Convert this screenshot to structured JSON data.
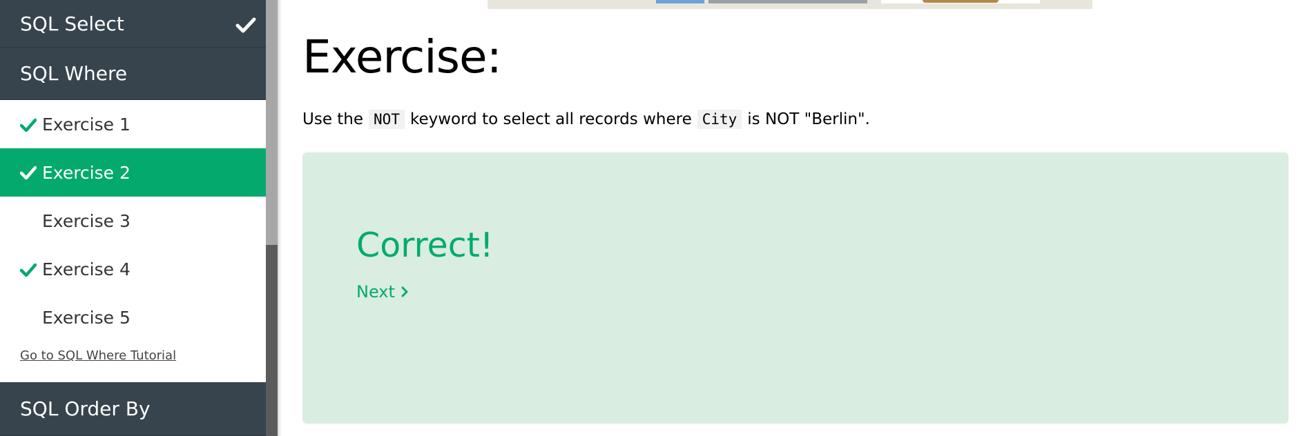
{
  "sidebar": {
    "sections": [
      {
        "label": "SQL Select",
        "completed": true
      },
      {
        "label": "SQL Where",
        "completed": false
      },
      {
        "label": "SQL Order By",
        "completed": false
      }
    ],
    "exercises": [
      {
        "label": "Exercise 1",
        "completed": true,
        "active": false
      },
      {
        "label": "Exercise 2",
        "completed": true,
        "active": true
      },
      {
        "label": "Exercise 3",
        "completed": false,
        "active": false
      },
      {
        "label": "Exercise 4",
        "completed": true,
        "active": false
      },
      {
        "label": "Exercise 5",
        "completed": false,
        "active": false
      }
    ],
    "tutorial_link": "Go to SQL Where Tutorial"
  },
  "main": {
    "title": "Exercise:",
    "instruction": {
      "part1": "Use the",
      "code1": "NOT",
      "part2": "keyword to select all records where",
      "code2": "City",
      "part3": "is NOT \"Berlin\"."
    },
    "result": {
      "status": "Correct!",
      "next_label": "Next"
    }
  },
  "colors": {
    "accent": "#04aa6d",
    "sidebar_header": "#38444d",
    "result_bg": "#d9ede1"
  },
  "icons": {
    "section_check": "checkmark-icon",
    "exercise_check": "checkmark-icon",
    "next": "chevron-right-icon"
  }
}
